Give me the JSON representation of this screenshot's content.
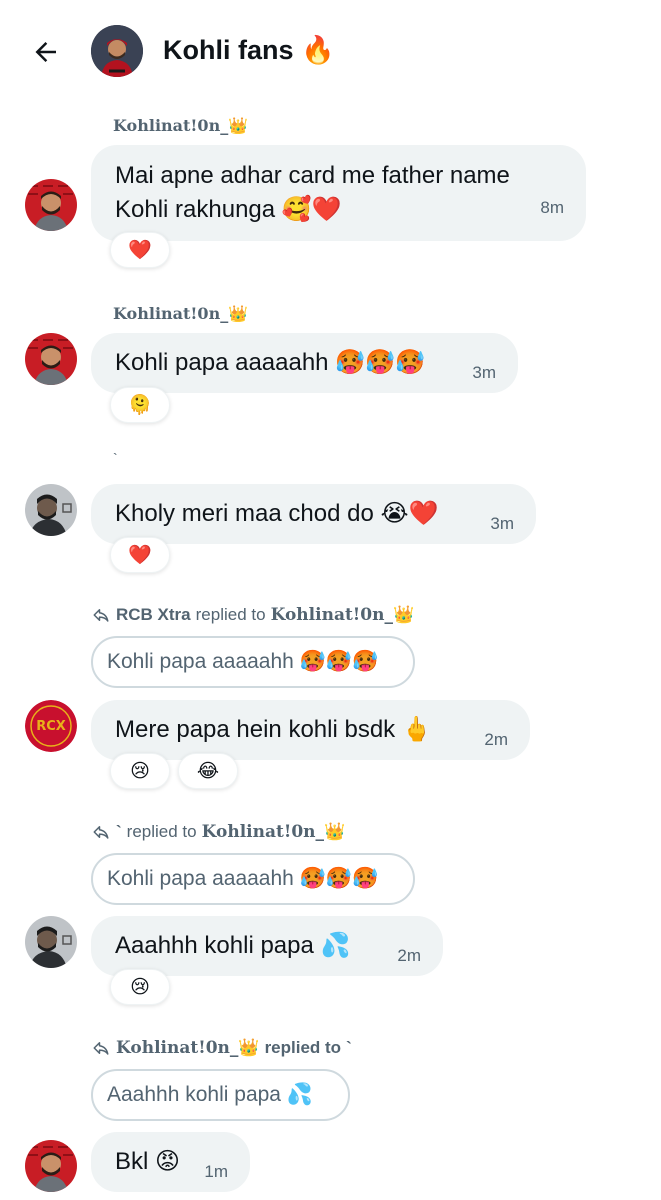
{
  "header": {
    "title": "Kohli fans 🔥"
  },
  "messages": [
    {
      "sender": "Kohlinat!0n_👑",
      "line1": "Mai apne adhar card me father name",
      "line2": "Kohli rakhunga 🥰❤️",
      "time": "8m",
      "reaction": "❤️"
    },
    {
      "sender": "Kohlinat!0n_👑",
      "text": "Kohli papa aaaaahh 🥵🥵🥵",
      "time": "3m",
      "reaction": "🫠"
    },
    {
      "sender": "`",
      "text": "Kholy meri maa chod do 😭❤️",
      "time": "3m",
      "reaction": "❤️"
    },
    {
      "reply_sender": "RCB Xtra",
      "reply_mid": "replied to",
      "reply_target": "Kohlinat!0n_👑",
      "quote": "Kohli papa aaaaahh 🥵🥵🥵",
      "text": "Mere papa hein kohli bsdk 🖕",
      "time": "2m",
      "reactions": [
        "😢",
        "😂"
      ]
    },
    {
      "reply_sender": "`",
      "reply_mid": "replied to",
      "reply_target": "Kohlinat!0n_👑",
      "quote": "Kohli papa aaaaahh 🥵🥵🥵",
      "text": "Aaahhh kohli papa 💦",
      "time": "2m",
      "reaction": "😢"
    },
    {
      "reply_sender": "Kohlinat!0n_👑",
      "reply_mid": "replied to",
      "reply_target": "`",
      "quote": "Aaahhh kohli papa 💦",
      "text": "Bkl 😡",
      "time": "1m"
    }
  ],
  "icons": {
    "back": "arrow-left-icon",
    "reply": "reply-arrow-icon"
  },
  "colors": {
    "bubble": "#eff3f4",
    "muted_text": "#536471",
    "quote_border": "#cfd9de",
    "rcb_red": "#c8102e",
    "gold": "#e8b21a"
  }
}
